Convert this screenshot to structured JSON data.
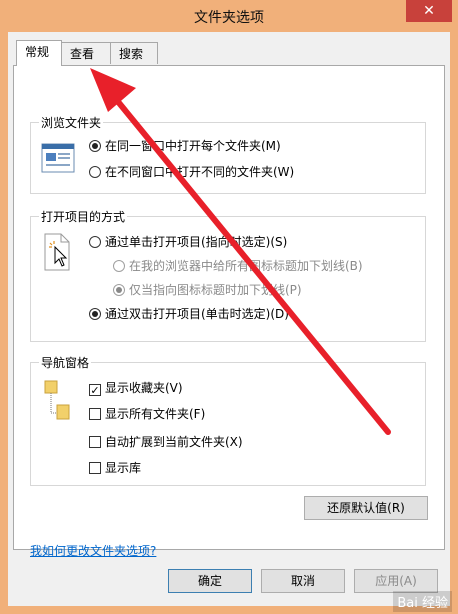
{
  "window": {
    "title": "文件夹选项",
    "close_label": "✕"
  },
  "tabs": [
    {
      "label": "常规",
      "active": true
    },
    {
      "label": "查看",
      "active": false
    },
    {
      "label": "搜索",
      "active": false
    }
  ],
  "browse_folders": {
    "title": "浏览文件夹",
    "options": [
      {
        "label": "在同一窗口中打开每个文件夹(M)",
        "checked": true
      },
      {
        "label": "在不同窗口中打开不同的文件夹(W)",
        "checked": false
      }
    ]
  },
  "open_items": {
    "title": "打开项目的方式",
    "options": [
      {
        "label": "通过单击打开项目(指向时选定)(S)",
        "checked": false,
        "enabled": true
      },
      {
        "label": "在我的浏览器中给所有图标标题加下划线(B)",
        "checked": false,
        "enabled": false
      },
      {
        "label": "仅当指向图标标题时加下划线(P)",
        "checked": true,
        "enabled": false
      },
      {
        "label": "通过双击打开项目(单击时选定)(D)",
        "checked": true,
        "enabled": true
      }
    ]
  },
  "nav_pane": {
    "title": "导航窗格",
    "options": [
      {
        "label": "显示收藏夹(V)",
        "checked": true
      },
      {
        "label": "显示所有文件夹(F)",
        "checked": false
      },
      {
        "label": "自动扩展到当前文件夹(X)",
        "checked": false
      },
      {
        "label": "显示库",
        "checked": false
      }
    ]
  },
  "restore_defaults_label": "还原默认值(R)",
  "help_link": "我如何更改文件夹选项?",
  "footer": {
    "ok_label": "确定",
    "cancel_label": "取消",
    "apply_label": "应用(A)"
  },
  "watermark": "Bai 经验",
  "colors": {
    "window_frame": "#f1b07a",
    "close_button": "#c8413b",
    "arrow": "#e8202a",
    "link": "#0066cc"
  }
}
